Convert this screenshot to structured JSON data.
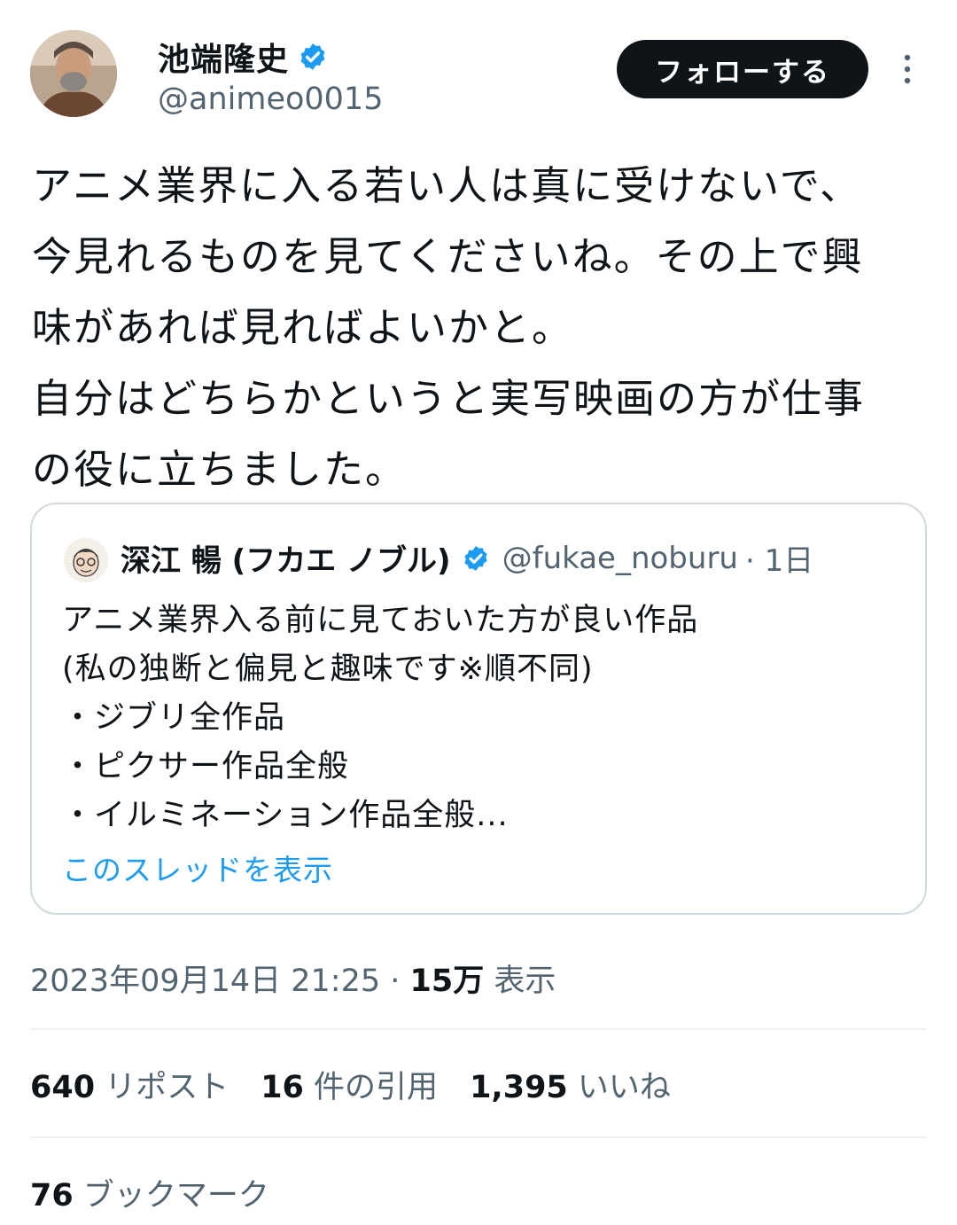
{
  "author": {
    "display_name": "池端隆史",
    "handle": "@animeo0015"
  },
  "follow_label": "フォローする",
  "tweet_lines": [
    "アニメ業界に入る若い人は真に受けないで、",
    "今見れるものを見てくださいね。その上で興",
    "味があれば見ればよいかと。",
    "自分はどちらかというと実写映画の方が仕事",
    "の役に立ちました。"
  ],
  "quote": {
    "display_name": "深江 暢 (フカエ ノブル)",
    "handle": "@fukae_noburu",
    "time": "· 1日",
    "lines": [
      "アニメ業界入る前に見ておいた方が良い作品",
      "(私の独断と偏見と趣味です※順不同)",
      "・ジブリ全作品",
      "・ピクサー作品全般",
      "・イルミネーション作品全般..."
    ],
    "show_thread": "このスレッドを表示"
  },
  "meta": {
    "timestamp": "2023年09月14日 21:25",
    "separator": " · ",
    "views_count": "15万",
    "views_label": " 表示"
  },
  "stats": {
    "reposts_count": "640",
    "reposts_label": " リポスト",
    "quotes_count": "16",
    "quotes_label": " 件の引用",
    "likes_count": "1,395",
    "likes_label": " いいね",
    "bookmarks_count": "76",
    "bookmarks_label": " ブックマーク"
  },
  "colors": {
    "text": "#0f1419",
    "secondary": "#536471",
    "link": "#1d9bf0",
    "border": "#cfd9de"
  }
}
